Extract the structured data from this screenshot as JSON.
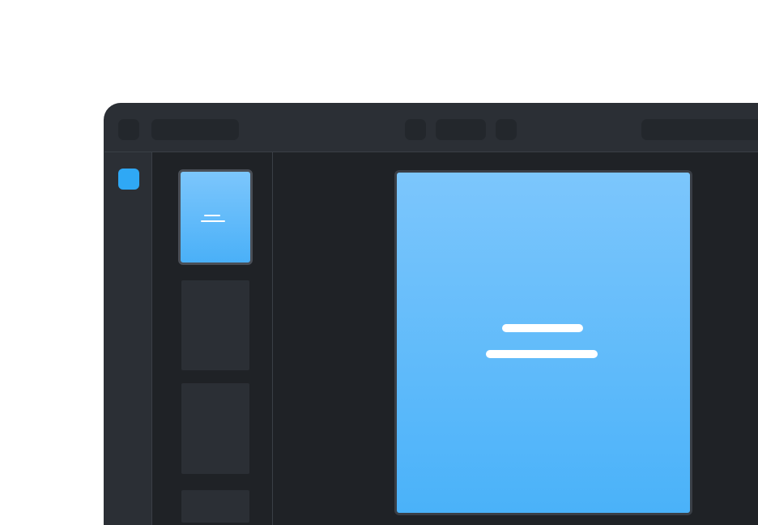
{
  "colors": {
    "window_bg": "#1f2226",
    "chrome_bg": "#2b2f35",
    "placeholder_block": "#23272c",
    "accent": "#2fa8f5",
    "slide_gradient_top": "#7cc6fc",
    "slide_gradient_bottom": "#4ab2f9"
  },
  "titlebar": {
    "icons": [
      "menu-icon",
      "previous-icon",
      "next-icon"
    ]
  },
  "thumbnails": {
    "count_visible": 4,
    "selected_index": 0
  }
}
